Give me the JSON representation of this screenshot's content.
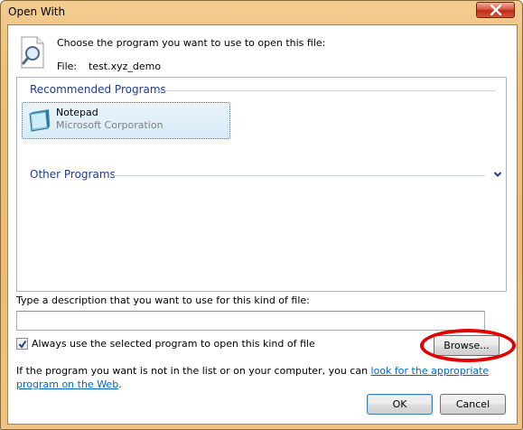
{
  "window": {
    "title": "Open With"
  },
  "header": {
    "instruction": "Choose the program you want to use to open this file:",
    "file_label": "File:",
    "file_name": "test.xyz_demo"
  },
  "programs": {
    "recommended_header": "Recommended Programs",
    "items": [
      {
        "name": "Notepad",
        "company": "Microsoft Corporation",
        "icon": "notepad-icon"
      }
    ],
    "other_header": "Other Programs"
  },
  "description": {
    "label": "Type a description that you want to use for this kind of file:",
    "value": "",
    "placeholder": ""
  },
  "always_use": {
    "label": "Always use the selected program to open this kind of file",
    "checked": true
  },
  "buttons": {
    "browse": "Browse...",
    "ok": "OK",
    "cancel": "Cancel"
  },
  "info": {
    "text": "If the program you want is not in the list or on your computer, you can ",
    "link": "look for the appropriate program on the Web",
    "suffix": "."
  },
  "colors": {
    "frame": "#eebc74",
    "group_header": "#1e3c8c",
    "link": "#0066cc",
    "highlight": "#e00000"
  }
}
